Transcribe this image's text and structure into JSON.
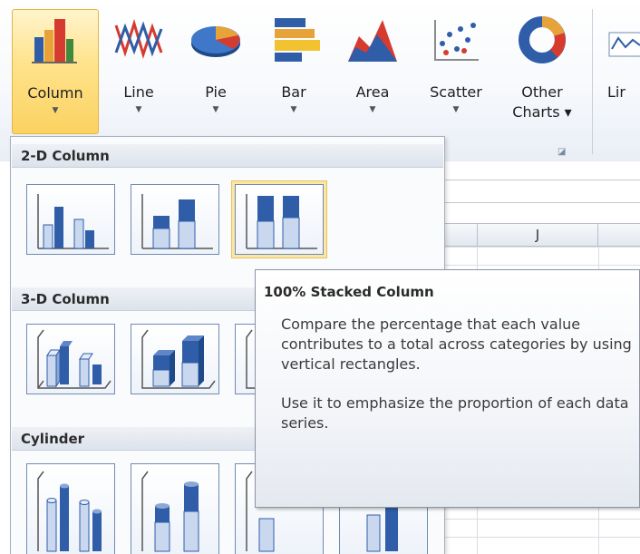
{
  "colors": {
    "accent_selected": "#fbd262",
    "chart_blue": "#2f5da8",
    "chart_light": "#c9d8ef",
    "ribbon_bg": "#f7f9fc"
  },
  "ribbon": {
    "buttons": [
      {
        "id": "column",
        "label": "Column",
        "icon": "column-chart-icon",
        "selected": true
      },
      {
        "id": "line",
        "label": "Line",
        "icon": "line-chart-icon"
      },
      {
        "id": "pie",
        "label": "Pie",
        "icon": "pie-chart-icon"
      },
      {
        "id": "bar",
        "label": "Bar",
        "icon": "bar-chart-icon"
      },
      {
        "id": "area",
        "label": "Area",
        "icon": "area-chart-icon"
      },
      {
        "id": "scatter",
        "label": "Scatter",
        "icon": "scatter-chart-icon"
      },
      {
        "id": "other",
        "label_line1": "Other",
        "label_line2": "Charts ▾",
        "icon": "donut-chart-icon"
      }
    ],
    "partial_next_label": "Lir"
  },
  "gallery": {
    "sections": [
      {
        "title": "2-D Column"
      },
      {
        "title": "3-D Column"
      },
      {
        "title": "Cylinder"
      }
    ]
  },
  "sheet": {
    "column_header": "J"
  },
  "tooltip": {
    "title": "100% Stacked Column",
    "description": "Compare the percentage that each value contributes to a total across categories by using vertical rectangles.",
    "usage": "Use it to emphasize the proportion of each data series."
  }
}
